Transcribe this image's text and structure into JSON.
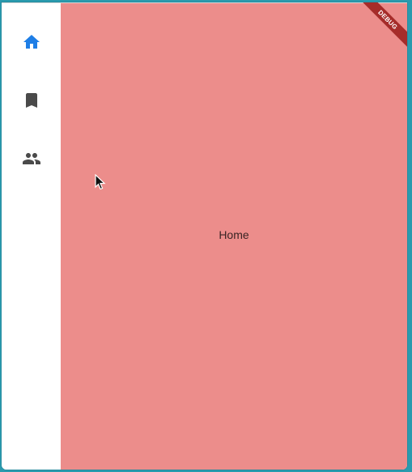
{
  "navigation_rail": {
    "items": [
      {
        "id": "home",
        "icon": "home-icon",
        "color": "#1e7ee6",
        "selected": true
      },
      {
        "id": "bookmarks",
        "icon": "bookmark-icon",
        "color": "#4a4a4a",
        "selected": false
      },
      {
        "id": "people",
        "icon": "people-icon",
        "color": "#4a4a4a",
        "selected": false
      }
    ]
  },
  "content": {
    "label": "Home",
    "background": "#ec8d8b"
  },
  "debug_banner": {
    "text": "DEBUG",
    "color": "#a62c2a"
  }
}
